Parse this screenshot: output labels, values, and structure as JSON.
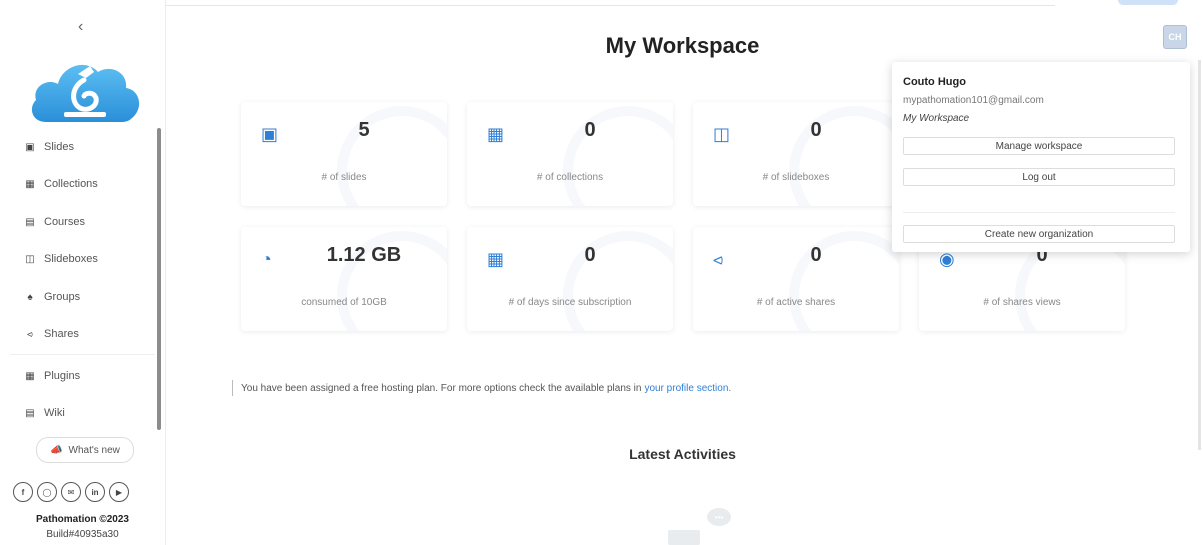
{
  "page": {
    "title": "My Workspace"
  },
  "sidebar": {
    "collapse_icon": "chevron-left-icon",
    "items": [
      {
        "label": "Slides",
        "icon": "slides-icon"
      },
      {
        "label": "Collections",
        "icon": "collections-icon"
      },
      {
        "label": "Courses",
        "icon": "courses-icon"
      },
      {
        "label": "Slideboxes",
        "icon": "slideboxes-icon"
      },
      {
        "label": "Groups",
        "icon": "groups-icon"
      },
      {
        "label": "Shares",
        "icon": "shares-icon"
      },
      {
        "label": "Plugins",
        "icon": "plugins-icon"
      },
      {
        "label": "Wiki",
        "icon": "wiki-icon"
      }
    ],
    "whats_new": "What's new",
    "socials": [
      "facebook-icon",
      "github-icon",
      "email-icon",
      "linkedin-icon",
      "youtube-icon"
    ],
    "copyright": "Pathomation ©2023",
    "build": "Build#40935a30"
  },
  "avatar": {
    "initials": "CH"
  },
  "stats": [
    {
      "value": "5",
      "label": "# of slides",
      "icon": "image-icon"
    },
    {
      "value": "0",
      "label": "# of collections",
      "icon": "collection-icon"
    },
    {
      "value": "0",
      "label": "# of slideboxes",
      "icon": "slidebox-icon"
    },
    {
      "value": "1.12 GB",
      "label": "consumed of 10GB",
      "icon": "pie-chart-icon"
    },
    {
      "value": "0",
      "label": "# of days since subscription",
      "icon": "calendar-icon"
    },
    {
      "value": "0",
      "label": "# of active shares",
      "icon": "share-icon"
    },
    {
      "value": "0",
      "label": "# of shares views",
      "icon": "eye-icon"
    }
  ],
  "notice": {
    "text": "You have been assigned a free hosting plan. For more options check the available plans in",
    "link": "your profile section."
  },
  "latest": {
    "title": "Latest Activities"
  },
  "user_menu": {
    "name": "Couto Hugo",
    "email": "mypathomation101@gmail.com",
    "workspace": "My Workspace",
    "manage": "Manage workspace",
    "logout": "Log out",
    "create_org": "Create new organization"
  },
  "colors": {
    "accent": "#2f7fd6",
    "logo": "#35a3e8"
  }
}
